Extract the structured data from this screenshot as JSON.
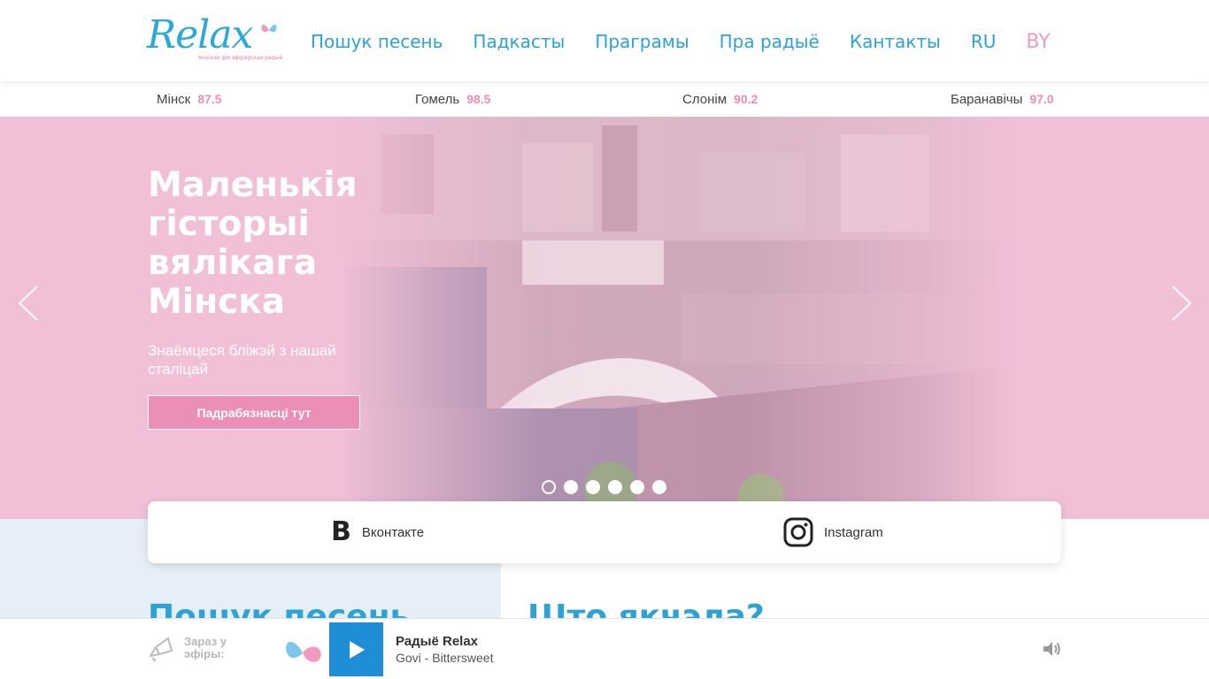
{
  "brand": {
    "logo_text": "Relax",
    "logo_tagline": "мінскае фм эфіраўскае радыё"
  },
  "nav": {
    "items": [
      "Пошук песень",
      "Падкасты",
      "Праграмы",
      "Пра радыё",
      "Кантакты"
    ],
    "lang": [
      "RU",
      "BY"
    ],
    "active_lang": "BY"
  },
  "frequencies": [
    {
      "city": "Мінск",
      "value": "87.5"
    },
    {
      "city": "Гомель",
      "value": "98.5"
    },
    {
      "city": "Слонім",
      "value": "90.2"
    },
    {
      "city": "Баранавічы",
      "value": "97.0"
    }
  ],
  "hero": {
    "title": "Маленькія гісторыі вялікага Мінска",
    "subtitle": "Знаёмцеся бліжэй з нашай сталіцай",
    "button": "Падрабязнасці тут",
    "slides_count": 6,
    "active_slide": 1
  },
  "social": {
    "vk_label": "Вконтакте",
    "ig_label": "Instagram"
  },
  "sections": {
    "left_title": "Пошук песень",
    "right_title": "Што якчэла?"
  },
  "player": {
    "live_label": "Зараз у эфіры:",
    "station": "Радыё Relax",
    "track": "Govi - Bittersweet"
  },
  "colors": {
    "brand_blue": "#2ba3d7",
    "brand_pink": "#f08bb8",
    "hero_pink": "#f2c1d8",
    "play_blue": "#1e8fd6"
  }
}
